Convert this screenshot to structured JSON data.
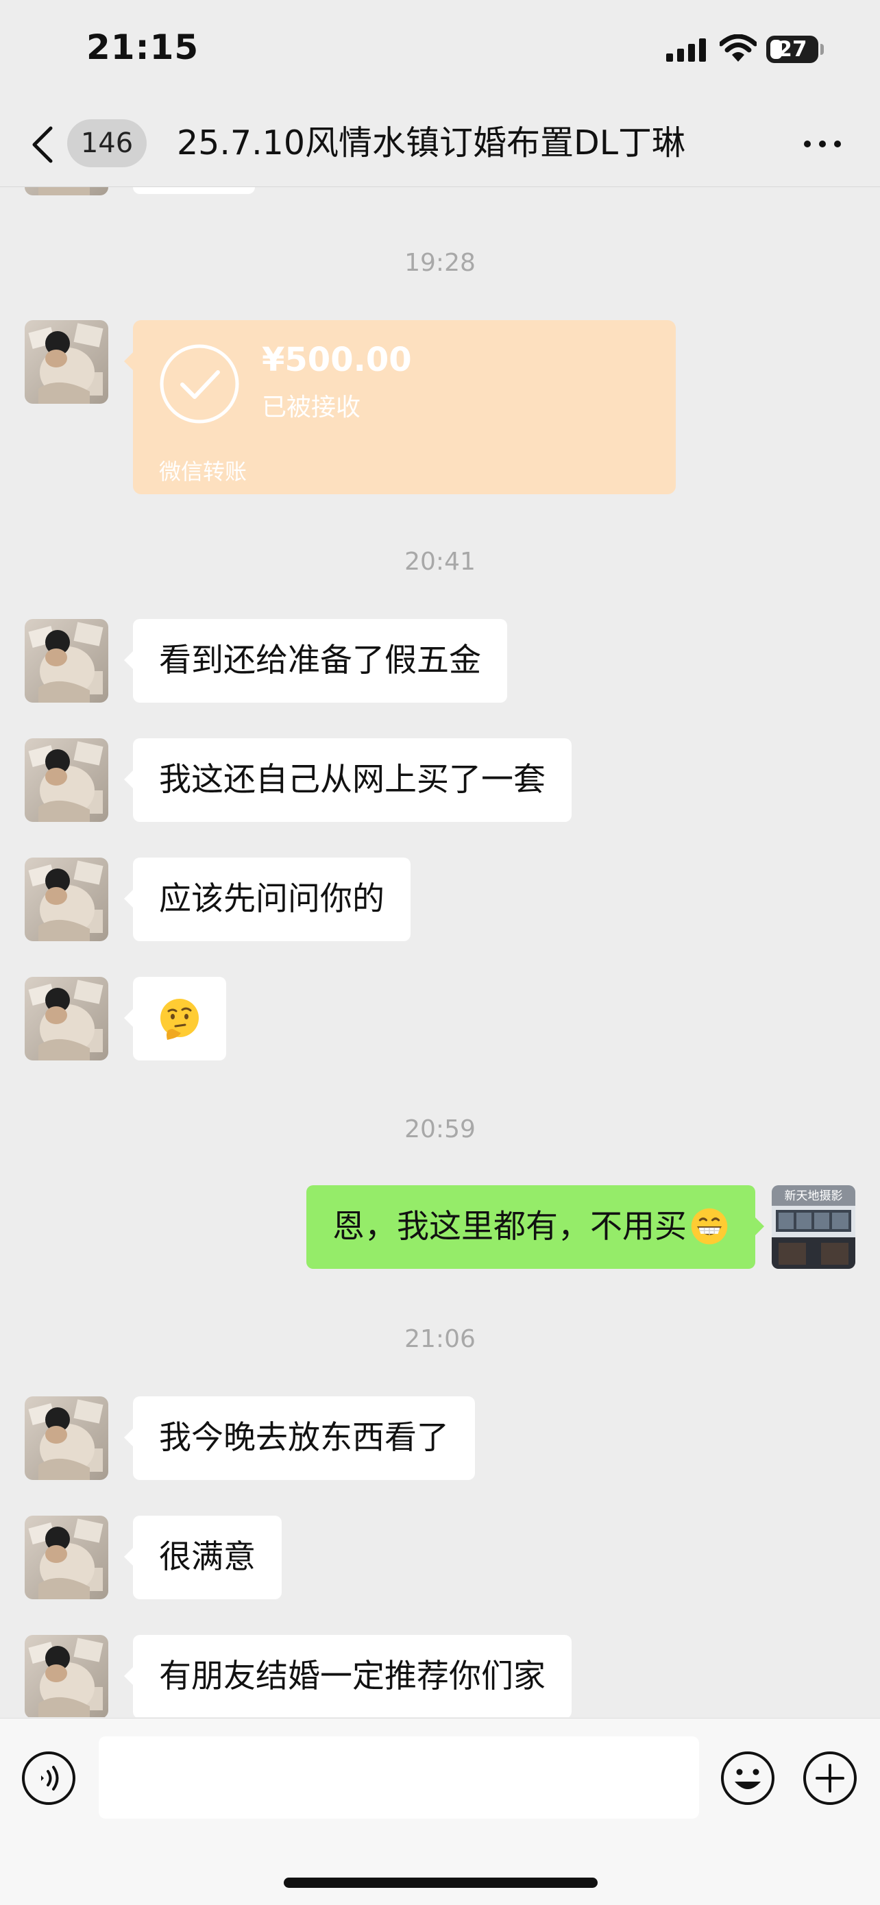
{
  "status_bar": {
    "time": "21:15",
    "battery": "27",
    "battery_level": 0.27
  },
  "nav": {
    "unread_count": "146",
    "title": "25.7.10风情水镇订婚布置DL丁琳"
  },
  "transfer": {
    "amount": "¥500.00",
    "status": "已被接收",
    "label": "微信转账"
  },
  "messages": {
    "t1": "19:28",
    "t2": "20:41",
    "m1": "看到还给准备了假五金",
    "m2": "我这还自己从网上买了一套",
    "m3": "应该先问问你的",
    "t3": "20:59",
    "self_msg": "恩，我这里都有，不用买",
    "t4": "21:06",
    "m5": "我今晚去放东西看了",
    "m6": "很满意",
    "m7": "有朋友结婚一定推荐你们家"
  },
  "self_avatar": {
    "sign": "新天地摄影"
  },
  "input": {
    "placeholder": ""
  },
  "icons": {
    "back": "chevron-left-icon",
    "more": "more-dots-icon",
    "voice": "voice-icon",
    "emoji": "emoji-face-icon",
    "plus": "plus-icon",
    "check": "check-circle-icon",
    "thinking": "thinking-face-emoji",
    "grin": "grinning-emoji"
  },
  "colors": {
    "background": "#ededed",
    "self_bubble": "#95ec69",
    "transfer_card": "#fde0bf"
  }
}
